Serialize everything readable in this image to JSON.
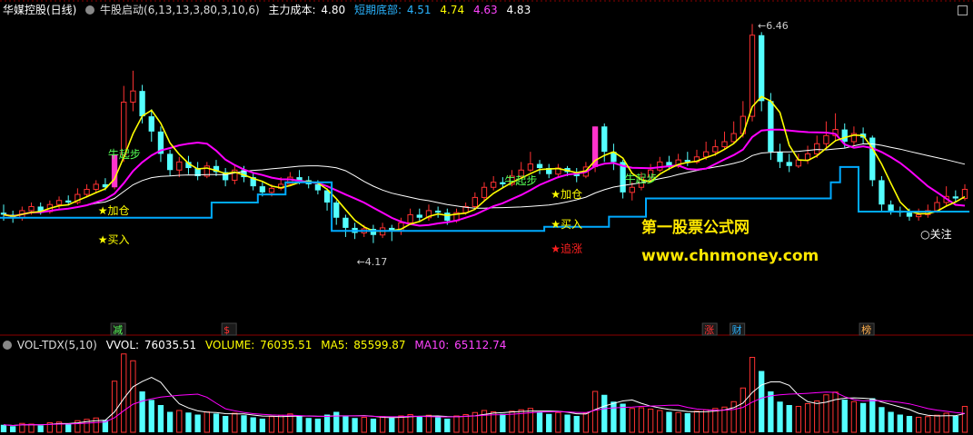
{
  "header": {
    "stock_title": "华媒控股(日线)",
    "indicator_name": "牛股启动(6,13,13,3,80,3,10,6)",
    "cost_label": "主力成本:",
    "cost_value": "4.80",
    "bottom_label": "短期底部:",
    "bottom_value": "4.51",
    "v2": "4.74",
    "v3": "4.63",
    "v4": "4.83"
  },
  "vol_header": {
    "name": "VOL-TDX(5,10)",
    "vvol_label": "VVOL:",
    "vvol_value": "76035.51",
    "volume_label": "VOLUME:",
    "volume_value": "76035.51",
    "ma5_label": "MA5:",
    "ma5_value": "85599.87",
    "ma10_label": "MA10:",
    "ma10_value": "65112.74"
  },
  "annotations": {
    "high_price": "6.46",
    "low_price": "4.17",
    "signals": [
      "牛起步",
      "加仓",
      "买入",
      "牛起步",
      "加仓",
      "买入",
      "追涨",
      "牛起步",
      "关注"
    ],
    "event_tags": [
      "减",
      "$",
      "涨",
      "财",
      "榜"
    ]
  },
  "watermark": {
    "line1": "第一股票公式网",
    "line2": "www.chnmoney.com"
  },
  "colors": {
    "bg": "#000000",
    "up": "#ff3232",
    "down": "#54ffff",
    "ma_yellow": "#ffff00",
    "ma_magenta": "#ff00ff",
    "ma_white": "#ffffff",
    "cost_line": "#00aaff",
    "signal_star": "#ffff00",
    "chase_star": "#ff2020"
  },
  "chart_data": {
    "type": "candlestick",
    "price_range": [
      4.17,
      6.46
    ],
    "candles": [
      [
        4.6,
        4.58,
        4.68,
        4.52
      ],
      [
        4.58,
        4.55,
        4.62,
        4.5
      ],
      [
        4.55,
        4.62,
        4.66,
        4.52
      ],
      [
        4.62,
        4.66,
        4.7,
        4.58
      ],
      [
        4.66,
        4.61,
        4.7,
        4.58
      ],
      [
        4.61,
        4.68,
        4.72,
        4.59
      ],
      [
        4.68,
        4.72,
        4.76,
        4.64
      ],
      [
        4.72,
        4.7,
        4.77,
        4.67
      ],
      [
        4.7,
        4.78,
        4.84,
        4.68
      ],
      [
        4.78,
        4.83,
        4.88,
        4.75
      ],
      [
        4.83,
        4.88,
        4.92,
        4.8
      ],
      [
        4.88,
        4.85,
        4.94,
        4.82
      ],
      [
        4.85,
        5.17,
        5.17,
        4.83
      ],
      [
        5.17,
        5.69,
        5.85,
        5.1
      ],
      [
        5.69,
        5.8,
        6.0,
        5.6
      ],
      [
        5.8,
        5.55,
        5.86,
        5.48
      ],
      [
        5.55,
        5.4,
        5.62,
        5.3
      ],
      [
        5.4,
        5.18,
        5.45,
        5.1
      ],
      [
        5.18,
        5.02,
        5.22,
        4.96
      ],
      [
        5.02,
        5.1,
        5.15,
        4.95
      ],
      [
        5.1,
        5.04,
        5.16,
        4.98
      ],
      [
        5.04,
        4.96,
        5.1,
        4.92
      ],
      [
        4.96,
        5.06,
        5.1,
        4.94
      ],
      [
        5.06,
        5.0,
        5.12,
        4.96
      ],
      [
        5.0,
        4.92,
        5.04,
        4.86
      ],
      [
        4.92,
        5.02,
        5.06,
        4.88
      ],
      [
        5.02,
        4.95,
        5.06,
        4.9
      ],
      [
        4.95,
        4.86,
        5.0,
        4.82
      ],
      [
        4.86,
        4.8,
        4.9,
        4.76
      ],
      [
        4.8,
        4.84,
        4.88,
        4.76
      ],
      [
        4.84,
        4.88,
        4.95,
        4.82
      ],
      [
        4.88,
        4.95,
        5.0,
        4.86
      ],
      [
        4.95,
        4.92,
        5.02,
        4.88
      ],
      [
        4.92,
        4.88,
        4.96,
        4.84
      ],
      [
        4.88,
        4.82,
        4.92,
        4.78
      ],
      [
        4.82,
        4.7,
        4.84,
        4.62
      ],
      [
        4.7,
        4.55,
        4.72,
        4.48
      ],
      [
        4.55,
        4.45,
        4.58,
        4.36
      ],
      [
        4.45,
        4.4,
        4.5,
        4.34
      ],
      [
        4.4,
        4.44,
        4.48,
        4.36
      ],
      [
        4.44,
        4.38,
        4.48,
        4.3
      ],
      [
        4.38,
        4.45,
        4.5,
        4.35
      ],
      [
        4.45,
        4.42,
        4.48,
        4.32
      ],
      [
        4.42,
        4.5,
        4.55,
        4.38
      ],
      [
        4.5,
        4.58,
        4.64,
        4.48
      ],
      [
        4.58,
        4.55,
        4.64,
        4.52
      ],
      [
        4.55,
        4.62,
        4.68,
        4.52
      ],
      [
        4.62,
        4.6,
        4.66,
        4.55
      ],
      [
        4.6,
        4.52,
        4.64,
        4.48
      ],
      [
        4.52,
        4.6,
        4.64,
        4.5
      ],
      [
        4.6,
        4.66,
        4.7,
        4.58
      ],
      [
        4.66,
        4.75,
        4.8,
        4.64
      ],
      [
        4.75,
        4.85,
        4.9,
        4.72
      ],
      [
        4.85,
        4.9,
        4.96,
        4.82
      ],
      [
        4.9,
        4.88,
        4.95,
        4.84
      ],
      [
        4.88,
        4.96,
        5.02,
        4.86
      ],
      [
        4.96,
        5.02,
        5.1,
        4.94
      ],
      [
        5.02,
        5.08,
        5.2,
        5.0
      ],
      [
        5.08,
        5.04,
        5.12,
        4.98
      ],
      [
        5.04,
        4.98,
        5.08,
        4.94
      ],
      [
        4.98,
        5.04,
        5.08,
        4.94
      ],
      [
        5.04,
        5.0,
        5.06,
        4.96
      ],
      [
        5.0,
        4.96,
        5.04,
        4.9
      ],
      [
        4.96,
        5.05,
        5.1,
        4.94
      ],
      [
        5.05,
        5.45,
        5.45,
        5.0
      ],
      [
        5.45,
        5.2,
        5.48,
        5.1
      ],
      [
        5.2,
        5.1,
        5.28,
        5.02
      ],
      [
        5.1,
        4.8,
        5.12,
        4.74
      ],
      [
        4.8,
        4.85,
        4.9,
        4.72
      ],
      [
        4.85,
        4.95,
        5.0,
        4.82
      ],
      [
        4.95,
        5.02,
        5.08,
        4.9
      ],
      [
        5.02,
        5.1,
        5.15,
        5.0
      ],
      [
        5.1,
        5.06,
        5.16,
        5.02
      ],
      [
        5.06,
        5.12,
        5.18,
        5.04
      ],
      [
        5.12,
        5.1,
        5.2,
        5.06
      ],
      [
        5.1,
        5.15,
        5.22,
        5.08
      ],
      [
        5.15,
        5.2,
        5.3,
        5.12
      ],
      [
        5.2,
        5.25,
        5.32,
        5.16
      ],
      [
        5.25,
        5.3,
        5.4,
        5.22
      ],
      [
        5.3,
        5.38,
        5.5,
        5.28
      ],
      [
        5.38,
        5.55,
        5.7,
        5.34
      ],
      [
        5.55,
        6.35,
        6.46,
        5.5
      ],
      [
        6.35,
        5.7,
        6.38,
        5.6
      ],
      [
        5.7,
        5.2,
        5.78,
        5.12
      ],
      [
        5.2,
        5.1,
        5.28,
        5.04
      ],
      [
        5.1,
        5.06,
        5.18,
        5.0
      ],
      [
        5.06,
        5.12,
        5.18,
        5.04
      ],
      [
        5.12,
        5.18,
        5.26,
        5.08
      ],
      [
        5.18,
        5.28,
        5.36,
        5.14
      ],
      [
        5.28,
        5.36,
        5.5,
        5.24
      ],
      [
        5.36,
        5.42,
        5.58,
        5.3
      ],
      [
        5.42,
        5.3,
        5.48,
        5.24
      ],
      [
        5.3,
        5.38,
        5.45,
        5.26
      ],
      [
        5.38,
        5.34,
        5.44,
        5.28
      ],
      [
        5.34,
        4.92,
        5.36,
        4.86
      ],
      [
        4.92,
        4.68,
        4.96,
        4.62
      ],
      [
        4.68,
        4.62,
        4.72,
        4.58
      ],
      [
        4.62,
        4.6,
        4.66,
        4.56
      ],
      [
        4.6,
        4.56,
        4.64,
        4.52
      ],
      [
        4.56,
        4.58,
        4.64,
        4.52
      ],
      [
        4.58,
        4.62,
        4.68,
        4.55
      ],
      [
        4.62,
        4.7,
        4.76,
        4.6
      ],
      [
        4.7,
        4.76,
        4.86,
        4.66
      ],
      [
        4.76,
        4.74,
        4.82,
        4.7
      ],
      [
        4.74,
        4.83,
        4.88,
        4.72
      ]
    ],
    "volume": [
      22000,
      18000,
      26000,
      24000,
      20000,
      28000,
      30000,
      26000,
      34000,
      38000,
      42000,
      36000,
      150000,
      230000,
      210000,
      120000,
      95000,
      80000,
      60000,
      64000,
      58000,
      52000,
      60000,
      55000,
      48000,
      56000,
      50000,
      44000,
      40000,
      46000,
      50000,
      54000,
      48000,
      42000,
      40000,
      52000,
      60000,
      48000,
      42000,
      44000,
      40000,
      46000,
      42000,
      48000,
      52000,
      46000,
      50000,
      44000,
      40000,
      48000,
      52000,
      58000,
      64000,
      60000,
      54000,
      62000,
      66000,
      70000,
      60000,
      54000,
      58000,
      52000,
      48000,
      56000,
      120000,
      110000,
      90000,
      84000,
      70000,
      72000,
      68000,
      64000,
      60000,
      58000,
      56000,
      62000,
      66000,
      70000,
      74000,
      90000,
      130000,
      220000,
      180000,
      120000,
      90000,
      80000,
      76000,
      84000,
      92000,
      110000,
      118000,
      96000,
      90000,
      86000,
      100000,
      74000,
      60000,
      52000,
      48000,
      44000,
      46000,
      50000,
      56000,
      48000,
      76035
    ]
  }
}
